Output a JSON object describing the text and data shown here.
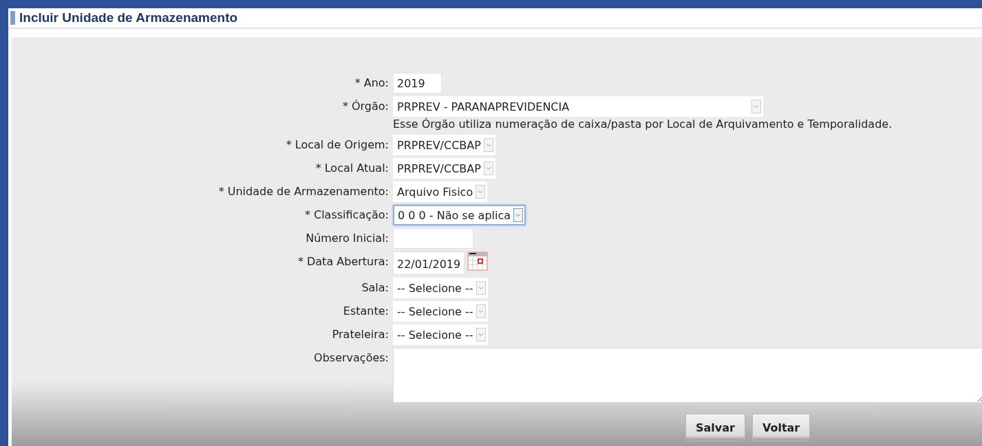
{
  "title": "Incluir Unidade de Armazenamento",
  "fields": [
    {
      "label": "* Ano:",
      "kind": "text",
      "value": "2019"
    },
    {
      "label": "* Órgão:",
      "kind": "select",
      "value": "PRPREV - PARANAPREVIDENCIA",
      "focused": false,
      "note": "Esse Órgão utiliza numeração de caixa/pasta por Local de Arquivamento e Temporalidade."
    },
    {
      "label": "* Local de Origem:",
      "kind": "select",
      "value": "PRPREV/CCBAP",
      "focused": false
    },
    {
      "label": "* Local Atual:",
      "kind": "select",
      "value": "PRPREV/CCBAP",
      "focused": false
    },
    {
      "label": "* Unidade de Armazenamento:",
      "kind": "select",
      "value": "Arquivo Fisico",
      "focused": false
    },
    {
      "label": "* Classificação:",
      "kind": "select",
      "value": "0 0 0 - Não se aplica",
      "focused": true
    },
    {
      "label": "Número Inicial:",
      "kind": "text"
    },
    {
      "label": "* Data Abertura:",
      "kind": "date",
      "value": "22/01/2019"
    },
    {
      "label": "Sala:",
      "kind": "select",
      "value": "-- Selecione --",
      "focused": false
    },
    {
      "label": "Estante:",
      "kind": "select",
      "value": "-- Selecione --",
      "focused": false
    },
    {
      "label": "Prateleira:",
      "kind": "select",
      "value": "-- Selecione --",
      "focused": false
    },
    {
      "label": "Observações:",
      "kind": "textarea"
    }
  ],
  "buttons": [
    "Salvar",
    "Voltar"
  ]
}
